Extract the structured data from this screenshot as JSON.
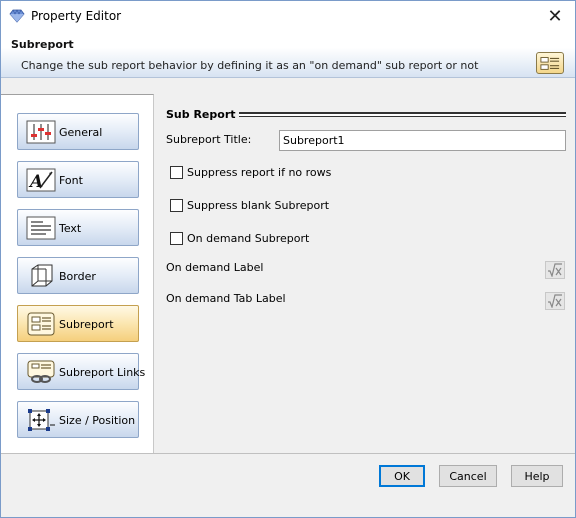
{
  "window": {
    "title": "Property Editor",
    "close_symbol": "✕"
  },
  "banner": {
    "title": "Subreport",
    "description": "Change the sub report behavior by defining it as an \"on demand\" sub report or not",
    "icon": "subreport-icon"
  },
  "sidebar": {
    "items": [
      {
        "label": "General",
        "icon": "sliders-icon",
        "active": false
      },
      {
        "label": "Font",
        "icon": "font-icon",
        "active": false
      },
      {
        "label": "Text",
        "icon": "text-icon",
        "active": false
      },
      {
        "label": "Border",
        "icon": "border-icon",
        "active": false
      },
      {
        "label": "Subreport",
        "icon": "subreport-icon",
        "active": true
      },
      {
        "label": "Subreport Links",
        "icon": "subreport-links-icon",
        "active": false
      },
      {
        "label": "Size / Position",
        "icon": "size-position-icon",
        "active": false
      }
    ]
  },
  "main": {
    "section_title": "Sub Report",
    "subreport_title_label": "Subreport Title:",
    "subreport_title_value": "Subreport1",
    "suppress_no_rows_label": "Suppress report if no rows",
    "suppress_blank_label": "Suppress blank Subreport",
    "on_demand_label": "On demand Subreport",
    "on_demand_caption_label": "On demand Label",
    "on_demand_tab_label": "On demand Tab Label",
    "expression_icon": "expression-icon"
  },
  "footer": {
    "ok": "OK",
    "cancel": "Cancel",
    "help": "Help"
  },
  "colors": {
    "accent": "#0078d7",
    "active_tab": "#f5cf7d",
    "nav_tab": "#c8d7ec"
  }
}
